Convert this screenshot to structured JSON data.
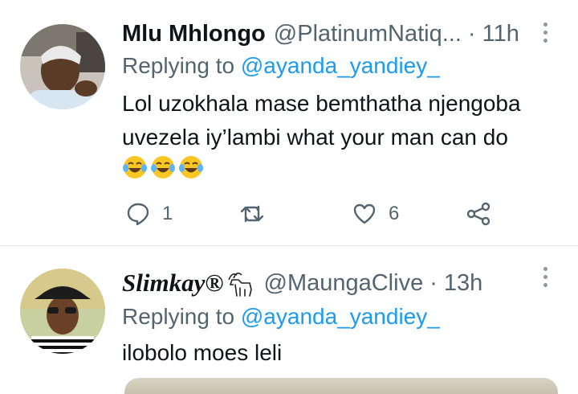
{
  "tweets": [
    {
      "name": "Mlu Mhlongo",
      "handle": "@PlatinumNatiq...",
      "separator": "·",
      "time": "11h",
      "replying_prefix": "Replying to",
      "replying_to": "@ayanda_yandiey_",
      "text": "Lol uzokhala mase bemthatha njengoba uvezela iy’lambi what your man can do",
      "emojis": [
        "face-with-tears-of-joy",
        "face-with-tears-of-joy",
        "face-with-tears-of-joy"
      ],
      "reply_count": "1",
      "retweet_count": "",
      "like_count": "6"
    },
    {
      "name": "Slimkay®",
      "handle": "@MaungaClive",
      "separator": "·",
      "time": "13h",
      "replying_prefix": "Replying to",
      "replying_to": "@ayanda_yandiey_",
      "text": "ilobolo moes leli"
    }
  ],
  "colors": {
    "primary_text": "#0f1419",
    "secondary_text": "#536471",
    "link": "#1d9bf0",
    "divider": "#e6e9eb"
  }
}
